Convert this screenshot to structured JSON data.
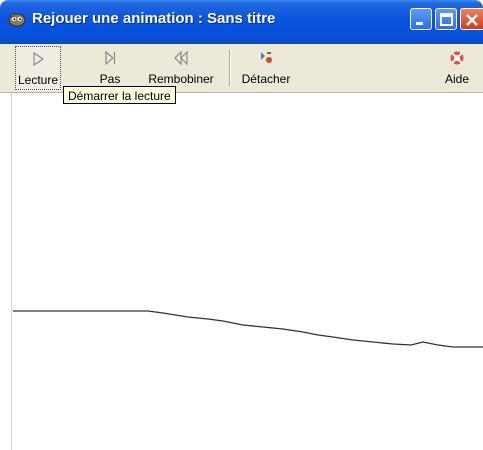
{
  "window": {
    "title": "Rejouer une animation :  Sans titre"
  },
  "toolbar": {
    "buttons": [
      {
        "label": "Lecture",
        "icon": "play-icon"
      },
      {
        "label": "Pas",
        "icon": "step-icon"
      },
      {
        "label": "Rembobiner",
        "icon": "rewind-icon"
      },
      {
        "label": "Détacher",
        "icon": "detach-icon"
      },
      {
        "label": "Aide",
        "icon": "help-lifebuoy-icon"
      }
    ]
  },
  "tooltip": {
    "text": "Démarrer la lecture"
  },
  "colors": {
    "titlebar": "#0a54e0",
    "toolbar_bg": "#ece9d8",
    "tooltip_bg": "#ffffe1",
    "close_button": "#cf3c1a",
    "drawn_line": "#333333"
  }
}
